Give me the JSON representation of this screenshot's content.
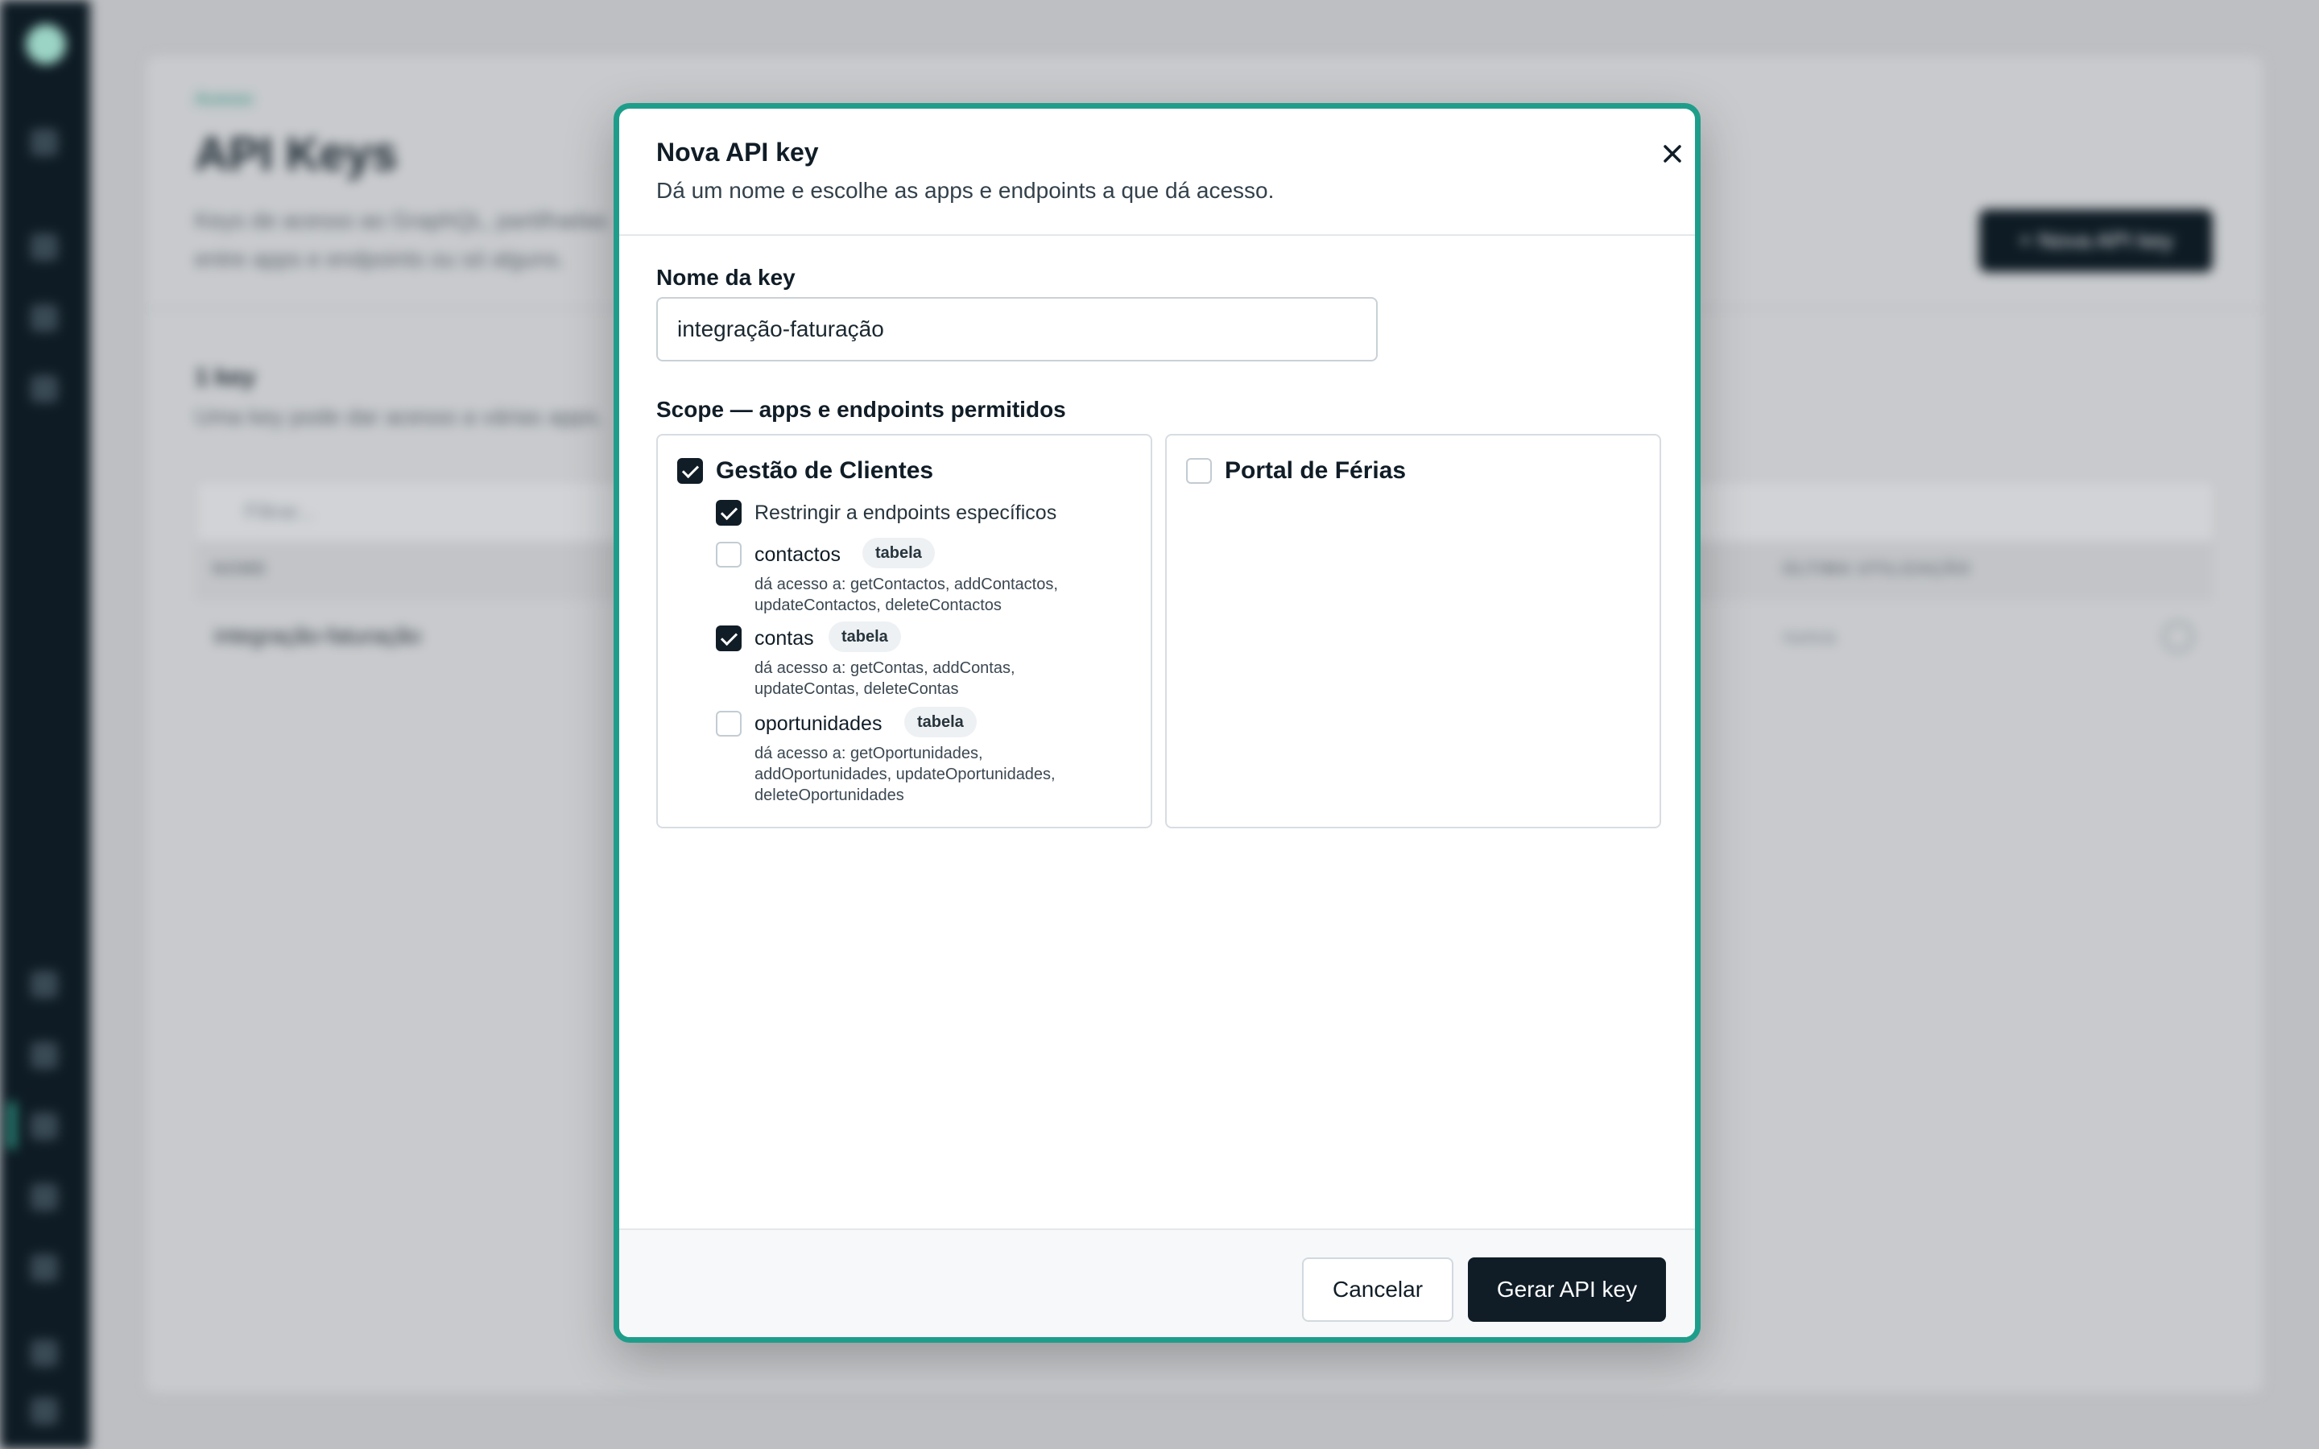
{
  "background": {
    "breadcrumb": "Acesso",
    "page_title": "API Keys",
    "page_subtitle": "Keys de acesso ao GraphQL, partilhadas entre apps e endpoints ou só alguns.",
    "new_key_button": "+ Nova API key",
    "key_count": "1 key",
    "section_desc": "Uma key pode dar acesso a várias apps.",
    "filter_placeholder": "Filtrar...",
    "columns": {
      "name": "NOME",
      "last_used": "ÚLTIMA UTILIZAÇÃO"
    },
    "rows": [
      {
        "name": "integração-faturação",
        "last_used": "nunca"
      }
    ]
  },
  "modal": {
    "title": "Nova API key",
    "description": "Dá um nome e escolhe as apps e endpoints a que dá acesso.",
    "name_label": "Nome da key",
    "name_value": "integração-faturação",
    "scope_label": "Scope — apps e endpoints permitidos",
    "apps": [
      {
        "name": "Gestão de Clientes",
        "checked": true,
        "restrict_label": "Restringir a endpoints específicos",
        "restrict_checked": true,
        "endpoints": [
          {
            "name": "contactos",
            "badge": "tabela",
            "checked": false,
            "desc_line1": "dá acesso a: getContactos, addContactos,",
            "desc_line2": "updateContactos, deleteContactos"
          },
          {
            "name": "contas",
            "badge": "tabela",
            "checked": true,
            "desc_line1": "dá acesso a: getContas, addContas,",
            "desc_line2": "updateContas, deleteContas"
          },
          {
            "name": "oportunidades",
            "badge": "tabela",
            "checked": false,
            "desc_line1": "dá acesso a: getOportunidades,",
            "desc_line2": "addOportunidades, updateOportunidades,",
            "desc_line3": "deleteOportunidades"
          }
        ]
      },
      {
        "name": "Portal de Férias",
        "checked": false
      }
    ],
    "cancel_label": "Cancelar",
    "submit_label": "Gerar API key"
  },
  "colors": {
    "modal_border": "#1f9d8b",
    "primary": "#101d27",
    "sidebar": "#0e1b24"
  }
}
